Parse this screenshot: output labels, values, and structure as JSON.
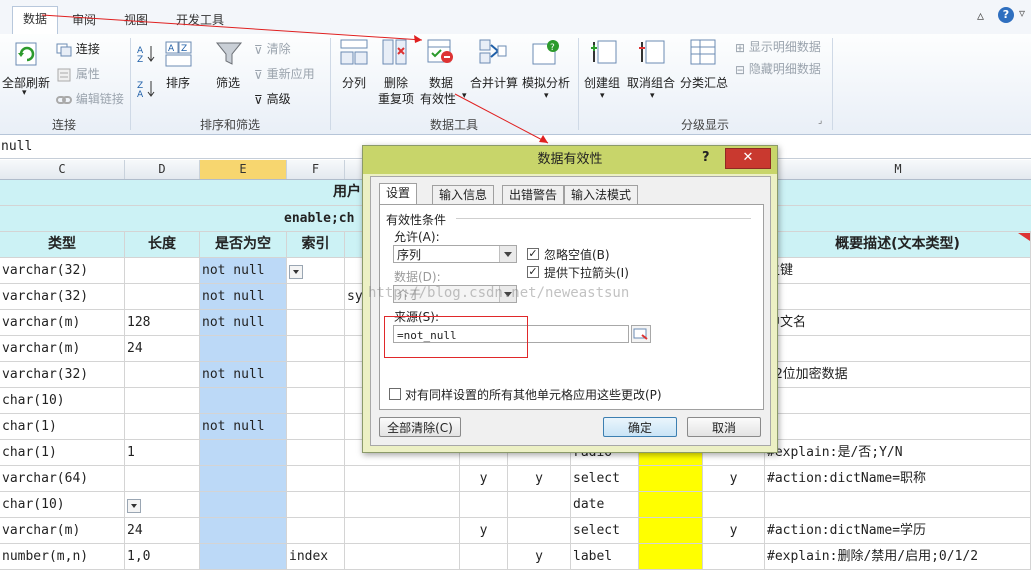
{
  "ribbon": {
    "tabs": [
      "数据",
      "审阅",
      "视图",
      "开发工具"
    ],
    "groups": {
      "connect": {
        "label": "连接",
        "refresh_all": "全部刷新",
        "connections": "连接",
        "properties": "属性",
        "edit_links": "编辑链接"
      },
      "sort_filter": {
        "label": "排序和筛选",
        "sort": "排序",
        "filter": "筛选",
        "clear": "清除",
        "reapply": "重新应用",
        "advanced": "高级"
      },
      "data_tools": {
        "label": "数据工具",
        "split": "分列",
        "remove_dup_1": "删除",
        "remove_dup_2": "重复项",
        "validation_1": "数据",
        "validation_2": "有效性",
        "consolidate": "合并计算",
        "what_if": "模拟分析"
      },
      "outline": {
        "label": "分级显示",
        "group": "创建组",
        "ungroup": "取消组合",
        "subtotal": "分类汇总",
        "show_detail": "显示明细数据",
        "hide_detail": "隐藏明细数据"
      }
    }
  },
  "formula_bar": {
    "value": "null"
  },
  "columns": [
    "C",
    "D",
    "E",
    "F",
    "M"
  ],
  "sheet": {
    "title_row": "用户",
    "subtitle_row": "enable;ch",
    "headers": {
      "type": "类型",
      "length": "长度",
      "nullable": "是否为空",
      "index": "索引",
      "desc": "概要描述(文本类型)"
    },
    "rows": [
      {
        "type": "varchar(32)",
        "length": "",
        "nullable": "not null",
        "index": "",
        "f": "",
        "h": "",
        "i": "",
        "j": "",
        "l": "",
        "desc": "主键"
      },
      {
        "type": "varchar(32)",
        "length": "",
        "nullable": "not null",
        "index": "",
        "f": "sy",
        "h": "",
        "i": "",
        "j": "",
        "l": "",
        "desc": ""
      },
      {
        "type": "varchar(m)",
        "length": "128",
        "nullable": "not null",
        "index": "",
        "f": "",
        "h": "",
        "i": "",
        "j": "",
        "l": "",
        "desc": "中文名"
      },
      {
        "type": "varchar(m)",
        "length": "24",
        "nullable": "",
        "index": "",
        "f": "",
        "h": "",
        "i": "",
        "j": "",
        "l": "",
        "desc": ""
      },
      {
        "type": "varchar(32)",
        "length": "",
        "nullable": "not null",
        "index": "",
        "f": "",
        "h": "",
        "i": "",
        "j": "",
        "l": "",
        "desc": "32位加密数据"
      },
      {
        "type": "char(10)",
        "length": "",
        "nullable": "",
        "index": "",
        "f": "",
        "h": "",
        "i": "",
        "j": "",
        "l": "",
        "desc": ""
      },
      {
        "type": "char(1)",
        "length": "",
        "nullable": "not null",
        "index": "",
        "f": "",
        "h": "",
        "i": "",
        "j": "",
        "l": "",
        "desc": ""
      },
      {
        "type": "char(1)",
        "length": "1",
        "nullable": "",
        "index": "",
        "f": "",
        "h": "",
        "i": "",
        "j": "radio",
        "l": "",
        "desc": "#explain:是/否;Y/N"
      },
      {
        "type": "varchar(64)",
        "length": "",
        "nullable": "",
        "index": "",
        "f": "",
        "h": "y",
        "i": "y",
        "j": "select",
        "l": "y",
        "desc": "#action:dictName=职称"
      },
      {
        "type": "char(10)",
        "length": "",
        "nullable": "",
        "index": "",
        "f": "",
        "h": "",
        "i": "",
        "j": "date",
        "l": "",
        "desc": ""
      },
      {
        "type": "varchar(m)",
        "length": "24",
        "nullable": "",
        "index": "",
        "f": "",
        "h": "y",
        "i": "",
        "j": "select",
        "l": "y",
        "desc": "#action:dictName=学历"
      },
      {
        "type": "number(m,n)",
        "length": "1,0",
        "nullable": "",
        "index": "index",
        "f": "",
        "h": "",
        "i": "y",
        "j": "label",
        "l": "",
        "desc": "#explain:删除/禁用/启用;0/1/2"
      }
    ]
  },
  "dialog": {
    "title": "数据有效性",
    "help": "?",
    "close": "✕",
    "tabs": [
      "设置",
      "输入信息",
      "出错警告",
      "输入法模式"
    ],
    "criteria_label": "有效性条件",
    "allow_label": "允许(A):",
    "allow_value": "序列",
    "ignore_blank": "忽略空值(B)",
    "dropdown": "提供下拉箭头(I)",
    "data_label": "数据(D):",
    "data_value": "介于",
    "source_label": "来源(S):",
    "source_value": "=not_null",
    "apply_all": "对有同样设置的所有其他单元格应用这些更改(P)",
    "clear_all": "全部清除(C)",
    "ok": "确定",
    "cancel": "取消"
  },
  "watermark": "http://blog.csdn.net/neweastsun"
}
